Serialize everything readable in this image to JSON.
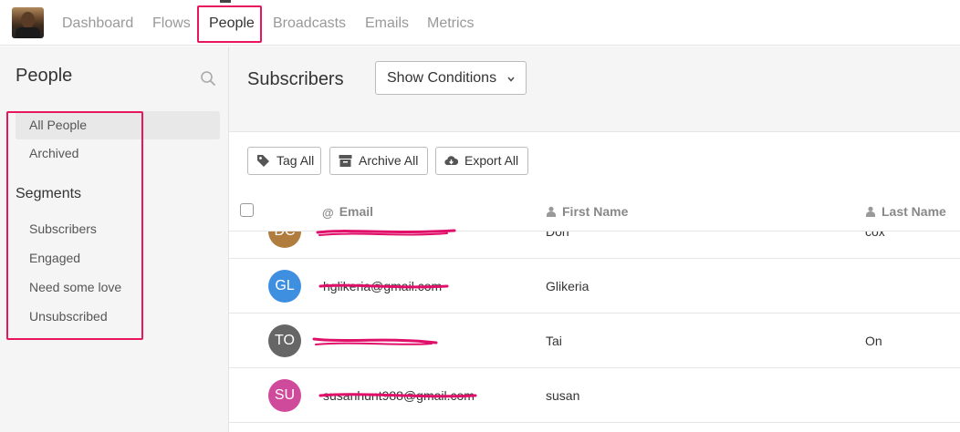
{
  "nav": {
    "items": [
      "Dashboard",
      "Flows",
      "People",
      "Broadcasts",
      "Emails",
      "Metrics"
    ],
    "active": "People"
  },
  "sidebar": {
    "title": "People",
    "items": [
      "All People",
      "Archived"
    ],
    "segments_heading": "Segments",
    "segments": [
      "Subscribers",
      "Engaged",
      "Need some love",
      "Unsubscribed"
    ]
  },
  "main": {
    "title": "Subscribers",
    "show_conditions": "Show Conditions",
    "actions": [
      "Tag All",
      "Archive All",
      "Export All"
    ]
  },
  "table": {
    "columns": [
      "Email",
      "First Name",
      "Last Name"
    ],
    "rows": [
      {
        "initials": "DC",
        "email": "",
        "first_name": "Don",
        "last_name": "cox",
        "color": "#b07d3f"
      },
      {
        "initials": "GL",
        "email": "hglikeria@gmail.com",
        "first_name": "Glikeria",
        "last_name": "",
        "color": "#3f8fe0"
      },
      {
        "initials": "TO",
        "email": "",
        "first_name": "Tai",
        "last_name": "On",
        "color": "#666666"
      },
      {
        "initials": "SU",
        "email": "susanhunt988@gmail.com",
        "first_name": "susan",
        "last_name": "",
        "color": "#d04a9c"
      }
    ]
  },
  "colors": {
    "highlight": "#e8165f",
    "redaction": "#e0106a"
  }
}
